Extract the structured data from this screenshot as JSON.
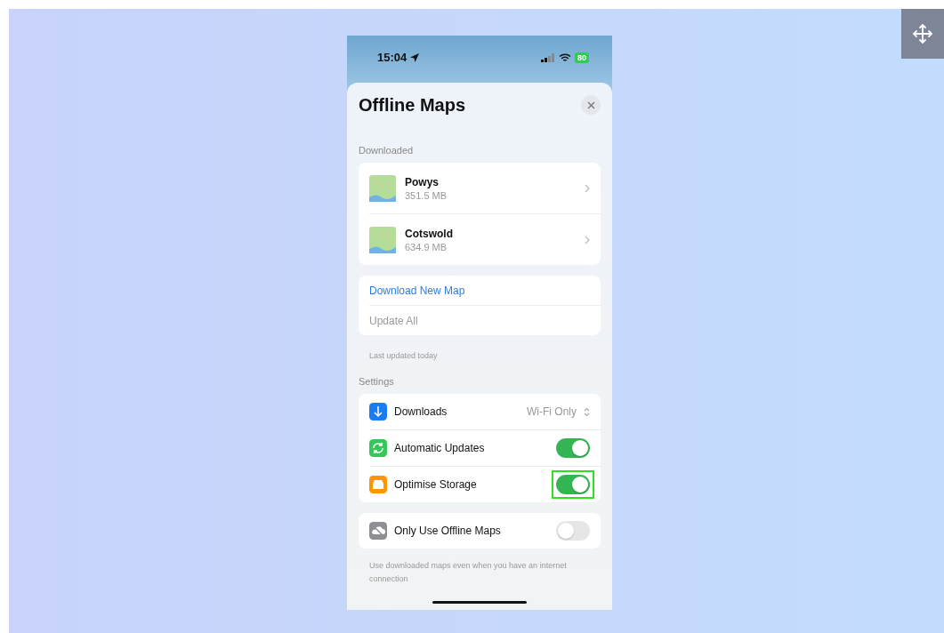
{
  "status_bar": {
    "time": "15:04",
    "battery": "80"
  },
  "sheet": {
    "title": "Offline Maps"
  },
  "downloaded": {
    "header": "Downloaded",
    "maps": [
      {
        "name": "Powys",
        "size": "351.5 MB"
      },
      {
        "name": "Cotswold",
        "size": "634.9 MB"
      }
    ]
  },
  "actions": [
    {
      "label": "Download New Map",
      "disabled": false
    },
    {
      "label": "Update All",
      "disabled": true
    }
  ],
  "last_updated": "Last updated today",
  "settings": {
    "header": "Settings",
    "items": [
      {
        "kind": "select",
        "label": "Downloads",
        "value": "Wi-Fi Only",
        "color": "#1a7cf5"
      },
      {
        "kind": "toggle",
        "label": "Automatic Updates",
        "on": true,
        "highlighted": false,
        "color": "#34c759"
      },
      {
        "kind": "toggle",
        "label": "Optimise Storage",
        "on": true,
        "highlighted": true,
        "color": "#ff9500"
      }
    ]
  },
  "offline": {
    "label": "Only Use Offline Maps",
    "on": false,
    "note": "Use downloaded maps even when you have an internet connection"
  }
}
